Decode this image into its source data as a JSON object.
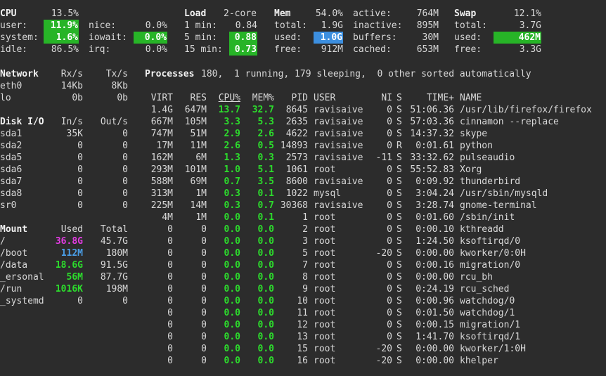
{
  "cpu": {
    "title": "CPU",
    "total": "13.5%",
    "user_label": "user:",
    "user": "11.9%",
    "system_label": "system:",
    "system": "1.6%",
    "idle_label": "idle:",
    "idle": "86.5%",
    "nice_label": "nice:",
    "nice": "0.0%",
    "iowait_label": "iowait:",
    "iowait": "0.0%",
    "irq_label": "irq:",
    "irq": "0.0%"
  },
  "load": {
    "title": "Load",
    "cores": "2-core",
    "m1_label": "1 min:",
    "m1": "0.84",
    "m5_label": "5 min:",
    "m5": "0.88",
    "m15_label": "15 min:",
    "m15": "0.73"
  },
  "mem": {
    "title": "Mem",
    "percent": "54.0%",
    "total_label": "total:",
    "total": "1.9G",
    "used_label": "used:",
    "used": "1.0G",
    "free_label": "free:",
    "free": "912M",
    "active_label": "active:",
    "active": "764M",
    "inactive_label": "inactive:",
    "inactive": "895M",
    "buffers_label": "buffers:",
    "buffers": "30M",
    "cached_label": "cached:",
    "cached": "653M"
  },
  "swap": {
    "title": "Swap",
    "percent": "12.1%",
    "total_label": "total:",
    "total": "3.7G",
    "used_label": "used:",
    "used": "462M",
    "free_label": "free:",
    "free": "3.3G"
  },
  "network": {
    "title": "Network",
    "rx_header": "Rx/s",
    "tx_header": "Tx/s",
    "rows": [
      {
        "name": "eth0",
        "rx": "14Kb",
        "tx": "8Kb"
      },
      {
        "name": "lo",
        "rx": "0b",
        "tx": "0b"
      }
    ]
  },
  "disk": {
    "title": "Disk I/O",
    "in_header": "In/s",
    "out_header": "Out/s",
    "rows": [
      {
        "name": "sda1",
        "in": "35K",
        "out": "0"
      },
      {
        "name": "sda2",
        "in": "0",
        "out": "0"
      },
      {
        "name": "sda5",
        "in": "0",
        "out": "0"
      },
      {
        "name": "sda6",
        "in": "0",
        "out": "0"
      },
      {
        "name": "sda7",
        "in": "0",
        "out": "0"
      },
      {
        "name": "sda8",
        "in": "0",
        "out": "0"
      },
      {
        "name": "sr0",
        "in": "0",
        "out": "0"
      }
    ]
  },
  "mount": {
    "title": "Mount",
    "used_header": "Used",
    "total_header": "Total",
    "rows": [
      {
        "name": "/",
        "used": "36.8G",
        "total": "45.7G",
        "color": "m"
      },
      {
        "name": "/boot",
        "used": "112M",
        "total": "180M",
        "color": "bl"
      },
      {
        "name": "/data",
        "used": "18.6G",
        "total": "91.5G",
        "color": "g"
      },
      {
        "name": "_ersonal",
        "used": "56M",
        "total": "87.7G",
        "color": "g"
      },
      {
        "name": "/run",
        "used": "1016K",
        "total": "198M",
        "color": "g"
      },
      {
        "name": "_systemd",
        "used": "0",
        "total": "0",
        "color": ""
      }
    ]
  },
  "processes": {
    "label": "Processes",
    "summary": "180,  1 running, 179 sleeping,  0 other sorted automatically",
    "headers": {
      "virt": "VIRT",
      "res": "RES",
      "cpu": "CPU%",
      "mem": "MEM%",
      "pid": "PID",
      "user": "USER",
      "ni": "NI",
      "s": "S",
      "time": "TIME+",
      "name": "NAME"
    },
    "rows": [
      {
        "virt": "1.4G",
        "res": "647M",
        "cpu": "13.7",
        "mem": "32.7",
        "pid": "8645",
        "user": "ravisaive",
        "ni": "0",
        "s": "S",
        "time": "51:06.36",
        "name": "/usr/lib/firefox/firefox"
      },
      {
        "virt": "667M",
        "res": "105M",
        "cpu": "3.3",
        "mem": "5.3",
        "pid": "2635",
        "user": "ravisaive",
        "ni": "0",
        "s": "S",
        "time": "57:03.36",
        "name": "cinnamon --replace"
      },
      {
        "virt": "747M",
        "res": "51M",
        "cpu": "2.9",
        "mem": "2.6",
        "pid": "4622",
        "user": "ravisaive",
        "ni": "0",
        "s": "S",
        "time": "14:37.32",
        "name": "skype"
      },
      {
        "virt": "17M",
        "res": "11M",
        "cpu": "2.6",
        "mem": "0.5",
        "pid": "14893",
        "user": "ravisaive",
        "ni": "0",
        "s": "R",
        "time": "0:01.61",
        "name": "python"
      },
      {
        "virt": "162M",
        "res": "6M",
        "cpu": "1.3",
        "mem": "0.3",
        "pid": "2573",
        "user": "ravisaive",
        "ni": "-11",
        "s": "S",
        "time": "33:32.62",
        "name": "pulseaudio"
      },
      {
        "virt": "293M",
        "res": "101M",
        "cpu": "1.0",
        "mem": "5.1",
        "pid": "1061",
        "user": "root",
        "ni": "0",
        "s": "S",
        "time": "55:52.83",
        "name": "Xorg"
      },
      {
        "virt": "588M",
        "res": "69M",
        "cpu": "0.7",
        "mem": "3.5",
        "pid": "8600",
        "user": "ravisaive",
        "ni": "0",
        "s": "S",
        "time": "0:09.92",
        "name": "thunderbird"
      },
      {
        "virt": "313M",
        "res": "1M",
        "cpu": "0.3",
        "mem": "0.1",
        "pid": "1022",
        "user": "mysql",
        "ni": "0",
        "s": "S",
        "time": "3:04.24",
        "name": "/usr/sbin/mysqld"
      },
      {
        "virt": "225M",
        "res": "14M",
        "cpu": "0.3",
        "mem": "0.7",
        "pid": "30368",
        "user": "ravisaive",
        "ni": "0",
        "s": "S",
        "time": "3:28.74",
        "name": "gnome-terminal"
      },
      {
        "virt": "4M",
        "res": "1M",
        "cpu": "0.0",
        "mem": "0.1",
        "pid": "1",
        "user": "root",
        "ni": "0",
        "s": "S",
        "time": "0:01.60",
        "name": "/sbin/init"
      },
      {
        "virt": "0",
        "res": "0",
        "cpu": "0.0",
        "mem": "0.0",
        "pid": "2",
        "user": "root",
        "ni": "0",
        "s": "S",
        "time": "0:00.10",
        "name": "kthreadd"
      },
      {
        "virt": "0",
        "res": "0",
        "cpu": "0.0",
        "mem": "0.0",
        "pid": "3",
        "user": "root",
        "ni": "0",
        "s": "S",
        "time": "1:24.50",
        "name": "ksoftirqd/0"
      },
      {
        "virt": "0",
        "res": "0",
        "cpu": "0.0",
        "mem": "0.0",
        "pid": "5",
        "user": "root",
        "ni": "-20",
        "s": "S",
        "time": "0:00.00",
        "name": "kworker/0:0H"
      },
      {
        "virt": "0",
        "res": "0",
        "cpu": "0.0",
        "mem": "0.0",
        "pid": "7",
        "user": "root",
        "ni": "0",
        "s": "S",
        "time": "0:00.16",
        "name": "migration/0"
      },
      {
        "virt": "0",
        "res": "0",
        "cpu": "0.0",
        "mem": "0.0",
        "pid": "8",
        "user": "root",
        "ni": "0",
        "s": "S",
        "time": "0:00.00",
        "name": "rcu_bh"
      },
      {
        "virt": "0",
        "res": "0",
        "cpu": "0.0",
        "mem": "0.0",
        "pid": "9",
        "user": "root",
        "ni": "0",
        "s": "S",
        "time": "0:24.19",
        "name": "rcu_sched"
      },
      {
        "virt": "0",
        "res": "0",
        "cpu": "0.0",
        "mem": "0.0",
        "pid": "10",
        "user": "root",
        "ni": "0",
        "s": "S",
        "time": "0:00.96",
        "name": "watchdog/0"
      },
      {
        "virt": "0",
        "res": "0",
        "cpu": "0.0",
        "mem": "0.0",
        "pid": "11",
        "user": "root",
        "ni": "0",
        "s": "S",
        "time": "0:01.50",
        "name": "watchdog/1"
      },
      {
        "virt": "0",
        "res": "0",
        "cpu": "0.0",
        "mem": "0.0",
        "pid": "12",
        "user": "root",
        "ni": "0",
        "s": "S",
        "time": "0:00.15",
        "name": "migration/1"
      },
      {
        "virt": "0",
        "res": "0",
        "cpu": "0.0",
        "mem": "0.0",
        "pid": "13",
        "user": "root",
        "ni": "0",
        "s": "S",
        "time": "1:41.70",
        "name": "ksoftirqd/1"
      },
      {
        "virt": "0",
        "res": "0",
        "cpu": "0.0",
        "mem": "0.0",
        "pid": "15",
        "user": "root",
        "ni": "-20",
        "s": "S",
        "time": "0:00.00",
        "name": "kworker/1:0H"
      },
      {
        "virt": "0",
        "res": "0",
        "cpu": "0.0",
        "mem": "0.0",
        "pid": "16",
        "user": "root",
        "ni": "-20",
        "s": "S",
        "time": "0:00.00",
        "name": "khelper"
      }
    ]
  },
  "colors": {
    "background": "#2c2c2c",
    "text": "#d8d8d8",
    "green_highlight": "#27b427",
    "blue_highlight": "#3c8fe0",
    "green_text": "#2cdc2c",
    "magenta_text": "#e23ce2",
    "blue_text": "#4a9ee6"
  }
}
